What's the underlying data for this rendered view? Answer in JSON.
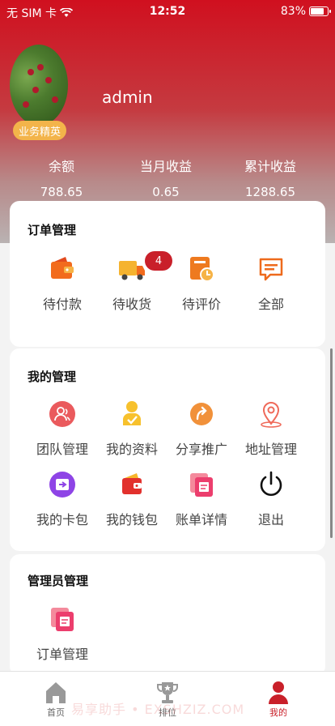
{
  "status_bar": {
    "carrier": "无 SIM 卡",
    "time": "12:52",
    "battery": "83%"
  },
  "profile": {
    "username": "admin",
    "badge": "业务精英"
  },
  "stats": [
    {
      "label": "余额",
      "value": "788.65"
    },
    {
      "label": "当月收益",
      "value": "0.65"
    },
    {
      "label": "累计收益",
      "value": "1288.65"
    }
  ],
  "orders": {
    "title": "订单管理",
    "items": [
      {
        "label": "待付款",
        "icon": "wallet-icon"
      },
      {
        "label": "待收货",
        "icon": "truck-icon",
        "badge": "4"
      },
      {
        "label": "待评价",
        "icon": "review-icon"
      },
      {
        "label": "全部",
        "icon": "message-list-icon"
      }
    ]
  },
  "my_management": {
    "title": "我的管理",
    "items": [
      {
        "label": "团队管理",
        "icon": "team-icon"
      },
      {
        "label": "我的资料",
        "icon": "profile-icon"
      },
      {
        "label": "分享推广",
        "icon": "share-icon"
      },
      {
        "label": "地址管理",
        "icon": "location-icon"
      },
      {
        "label": "我的卡包",
        "icon": "card-wallet-icon"
      },
      {
        "label": "我的钱包",
        "icon": "wallet-icon"
      },
      {
        "label": "账单详情",
        "icon": "bill-icon"
      },
      {
        "label": "退出",
        "icon": "power-icon"
      }
    ]
  },
  "admin_management": {
    "title": "管理员管理",
    "items": [
      {
        "label": "订单管理",
        "icon": "bill-icon"
      }
    ]
  },
  "tabbar": [
    {
      "label": "首页",
      "icon": "home-icon"
    },
    {
      "label": "排位",
      "icon": "trophy-icon"
    },
    {
      "label": "我的",
      "icon": "user-icon",
      "active": true
    }
  ],
  "watermark": "易享助手 • EXSHZIZ.COM",
  "colors": {
    "brand_red": "#d0101f",
    "badge_gold": "#f3b44a",
    "accent_orange": "#ee7a1f"
  }
}
